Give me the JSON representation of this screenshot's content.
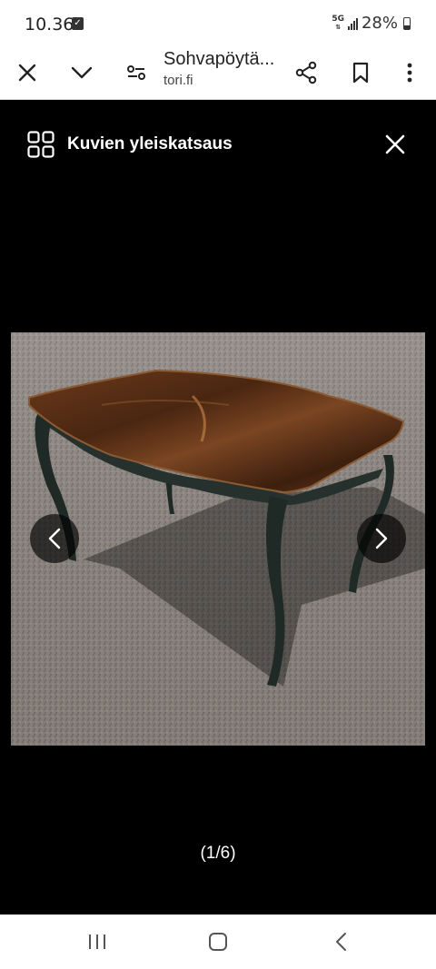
{
  "status_bar": {
    "time": "10.36",
    "network": "5G",
    "battery": "28%"
  },
  "toolbar": {
    "title": "Sohvapöytä...",
    "url": "tori.fi"
  },
  "viewer": {
    "header_title": "Kuvien yleiskatsaus",
    "counter": "(1/6)",
    "image_alt": "Antique coffee table with dark walnut top and dark green cabriole legs on asphalt"
  },
  "icons": {
    "close": "close-icon",
    "collapse": "chevron-down-icon",
    "site_settings": "tune-icon",
    "share": "share-icon",
    "bookmark": "bookmark-icon",
    "menu": "more-vert-icon",
    "overview": "grid-icon",
    "prev": "chevron-left-icon",
    "next": "chevron-right-icon"
  }
}
